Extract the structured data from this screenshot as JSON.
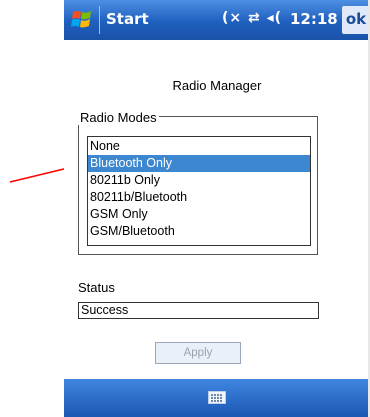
{
  "titlebar": {
    "start_label": "Start",
    "status_icons": "(× ⇄ ◂(",
    "time": "12:18",
    "ok_label": "ok"
  },
  "page_title": "Radio Manager",
  "radio_modes": {
    "label": "Radio Modes",
    "items": [
      "None",
      "Bluetooth Only",
      "80211b Only",
      "80211b/Bluetooth",
      "GSM Only",
      "GSM/Bluetooth"
    ],
    "selected_index": 1
  },
  "status": {
    "label": "Status",
    "value": "Success"
  },
  "apply_label": "Apply",
  "colors": {
    "titlebar": "#1f5fbf",
    "selection": "#3c87cf",
    "arrow": "#ff0000"
  }
}
